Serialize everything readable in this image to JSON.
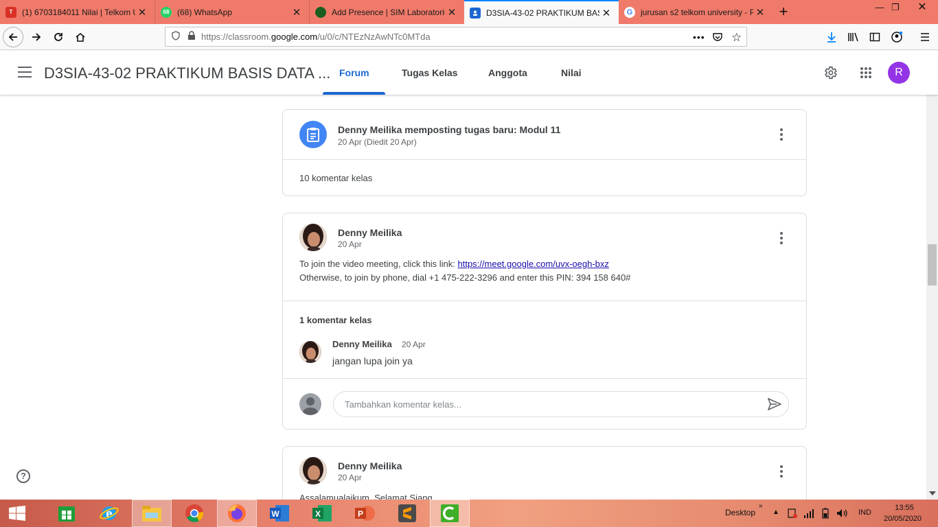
{
  "browser": {
    "tabs": [
      {
        "title": "(1) 6703184011 Nilai | Telkom U",
        "favicon_color": "#d93025",
        "favicon_text": "T"
      },
      {
        "title": "(68) WhatsApp",
        "favicon_color": "#25d366",
        "favicon_text": "68"
      },
      {
        "title": "Add Presence | SIM Laboratoriu",
        "favicon_color": "#2e7d32",
        "favicon_text": ""
      },
      {
        "title": "D3SIA-43-02 PRAKTIKUM BASIS",
        "favicon_color": "#1967d2",
        "favicon_text": ""
      },
      {
        "title": "jurusan s2 telkom university - P",
        "favicon_color": "#4285f4",
        "favicon_text": "G"
      }
    ],
    "url_prefix": "https://classroom.",
    "url_domain": "google.com",
    "url_path": "/u/0/c/NTEzNzAwNTc0MTda"
  },
  "classroom": {
    "class_title": "D3SIA-43-02 PRAKTIKUM BASIS DATA ...",
    "nav_tabs": [
      "Forum",
      "Tugas Kelas",
      "Anggota",
      "Nilai"
    ],
    "profile_initial": "R"
  },
  "posts": [
    {
      "title": "Denny Meilika memposting tugas baru: Modul 11",
      "date": "20 Apr (Diedit 20 Apr)",
      "comments_label": "10 komentar kelas"
    },
    {
      "author": "Denny Meilika",
      "date": "20 Apr",
      "body_line1_prefix": "To join the video meeting, click this link: ",
      "body_link": "https://meet.google.com/uvx-oegh-bxz",
      "body_line2": "Otherwise, to join by phone, dial +1 475-222-3296 and enter this PIN: 394 158 640#",
      "comments_label": "1 komentar kelas",
      "comment": {
        "author": "Denny Meilika",
        "date": "20 Apr",
        "text": "jangan lupa join ya"
      },
      "comment_placeholder": "Tambahkan komentar kelas..."
    },
    {
      "author": "Denny Meilika",
      "date": "20 Apr",
      "body_line1": "Assalamualaikum, Selamat Siang"
    }
  ],
  "taskbar": {
    "desktop_label": "Desktop",
    "language": "IND",
    "time": "13:55",
    "date": "20/05/2020"
  }
}
